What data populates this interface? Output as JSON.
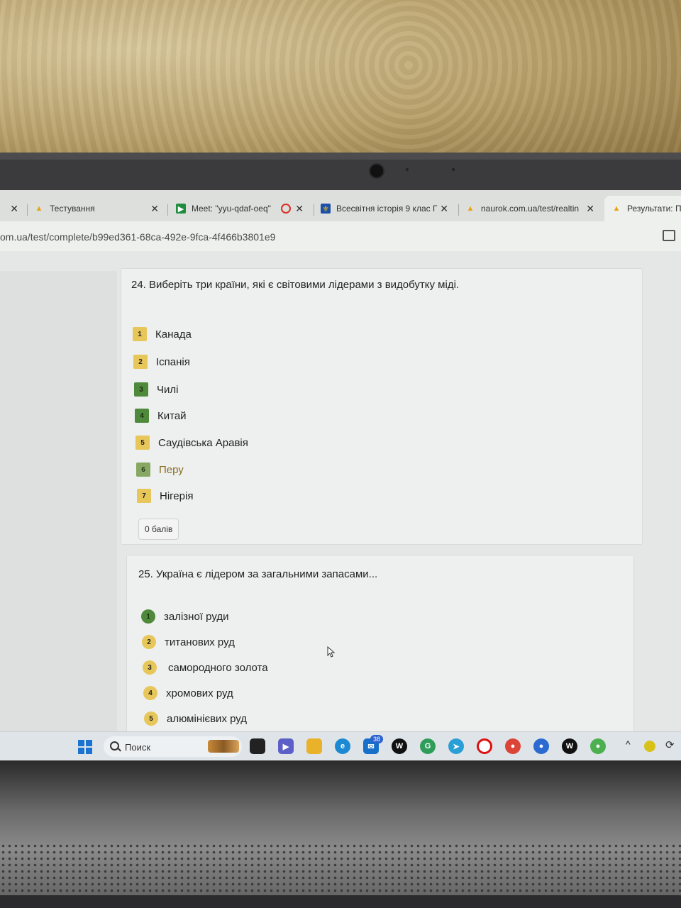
{
  "tabs": [
    {
      "label": "Тестування"
    },
    {
      "label": "Meet: \"yyu-qdaf-oeq\""
    },
    {
      "label": "Всесвітня історія 9 клас Г"
    },
    {
      "label": "naurok.com.ua/test/realtin"
    },
    {
      "label": "Результати: Пе"
    }
  ],
  "url": "om.ua/test/complete/b99ed361-68ca-492e-9fca-4f466b3801e9",
  "q24": {
    "title": "24. Виберіть три країни, які є світовими лідерами з видобутку міді.",
    "options": [
      {
        "num": "1",
        "text": "Канада"
      },
      {
        "num": "2",
        "text": "Іспанія"
      },
      {
        "num": "3",
        "text": "Чилі"
      },
      {
        "num": "4",
        "text": "Китай"
      },
      {
        "num": "5",
        "text": "Саудівська Аравія"
      },
      {
        "num": "6",
        "text": "Перу"
      },
      {
        "num": "7",
        "text": "Нігерія"
      }
    ],
    "score": "0 балів"
  },
  "q25": {
    "title": "25. Україна є лідером за загальними запасами...",
    "options": [
      {
        "num": "1",
        "text": "залізної руди"
      },
      {
        "num": "2",
        "text": "титанових руд"
      },
      {
        "num": "3",
        "text": "самородного золота"
      },
      {
        "num": "4",
        "text": "хромових руд"
      },
      {
        "num": "5",
        "text": "алюмінієвих руд"
      }
    ]
  },
  "taskbar": {
    "search_placeholder": "Поиск",
    "mail_badge": "38"
  }
}
